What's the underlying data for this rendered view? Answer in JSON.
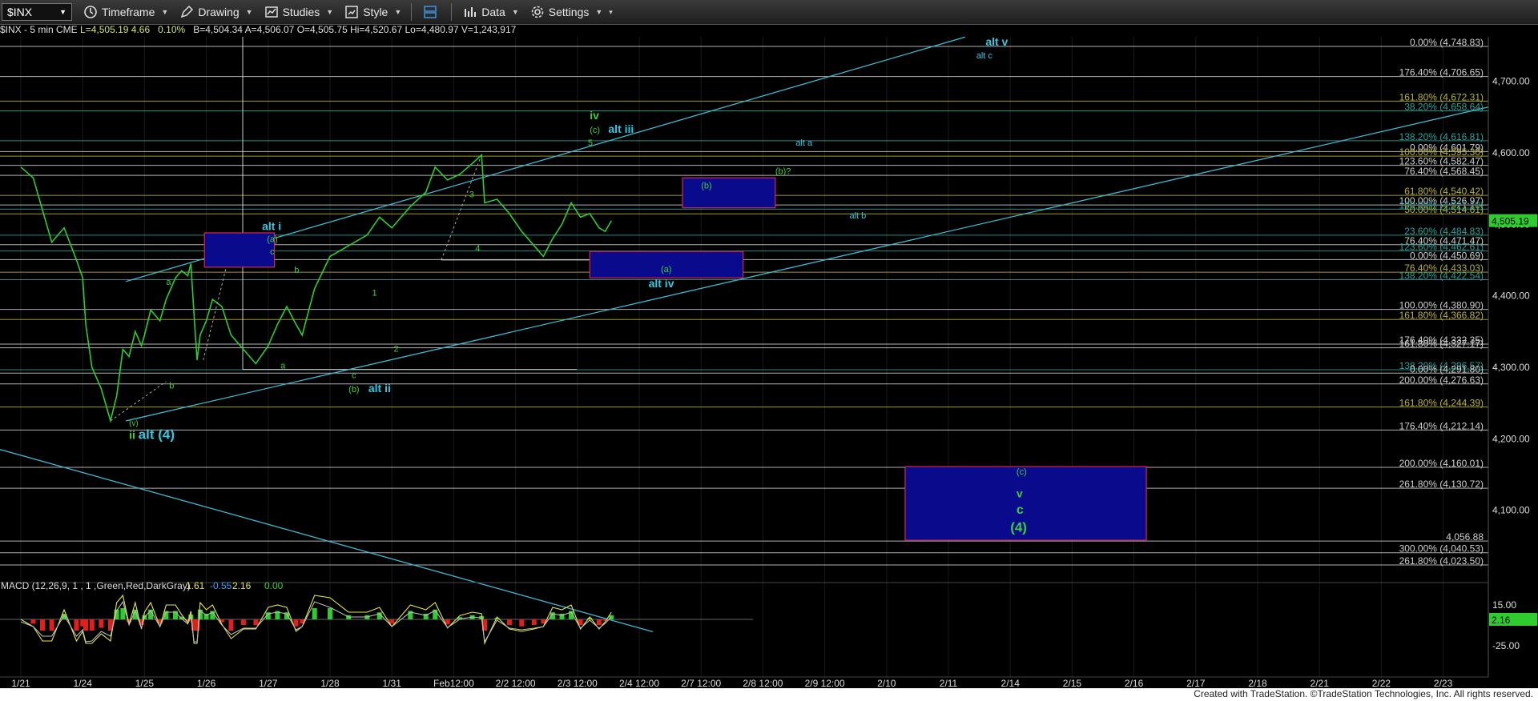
{
  "toolbar": {
    "symbol": "$INX",
    "items": [
      "Timeframe",
      "Drawing",
      "Studies",
      "Style",
      "Data",
      "Settings"
    ]
  },
  "infobar": {
    "symbol_line": "$INX - 5 min  CME",
    "last": "L=4,505.19",
    "change": "4.66",
    "change_pct": "0.10%",
    "bid": "B=4,504.34",
    "ask": "A=4,506.07",
    "open_ref": "O=4,505.75",
    "hi": "Hi=4,520.67",
    "lo": "Lo=4,480.97",
    "vol": "V=1,243,917"
  },
  "chart_data": {
    "type": "line",
    "title": "$INX - 5 min",
    "x_labels": [
      "1/21",
      "1/24",
      "1/25",
      "1/26",
      "1/27",
      "1/28",
      "1/31",
      "Feb12:00",
      "2/2 12:00",
      "2/3 12:00",
      "2/4 12:00",
      "2/7 12:00",
      "2/8 12:00",
      "2/9 12:00",
      "2/10",
      "2/11",
      "2/14",
      "2/15",
      "2/16",
      "2/17",
      "2/18",
      "2/21",
      "2/22",
      "2/23"
    ],
    "y_ticks": [
      "4,700.00",
      "4,600.00",
      "4,500.00",
      "4,400.00",
      "4,300.00",
      "4,200.00",
      "4,100.00"
    ],
    "ylim": [
      4010,
      4760
    ],
    "last_price_label": "4,505.19",
    "price_series": [
      {
        "x": 0.0,
        "y": 4580
      },
      {
        "x": 0.2,
        "y": 4565
      },
      {
        "x": 0.35,
        "y": 4520
      },
      {
        "x": 0.5,
        "y": 4475
      },
      {
        "x": 0.7,
        "y": 4495
      },
      {
        "x": 0.9,
        "y": 4450
      },
      {
        "x": 1.0,
        "y": 4425
      },
      {
        "x": 1.05,
        "y": 4360
      },
      {
        "x": 1.15,
        "y": 4300
      },
      {
        "x": 1.3,
        "y": 4270
      },
      {
        "x": 1.45,
        "y": 4225
      },
      {
        "x": 1.55,
        "y": 4260
      },
      {
        "x": 1.65,
        "y": 4325
      },
      {
        "x": 1.75,
        "y": 4315
      },
      {
        "x": 1.85,
        "y": 4350
      },
      {
        "x": 1.95,
        "y": 4330
      },
      {
        "x": 2.0,
        "y": 4345
      },
      {
        "x": 2.1,
        "y": 4380
      },
      {
        "x": 2.25,
        "y": 4365
      },
      {
        "x": 2.35,
        "y": 4395
      },
      {
        "x": 2.5,
        "y": 4425
      },
      {
        "x": 2.6,
        "y": 4435
      },
      {
        "x": 2.7,
        "y": 4428
      },
      {
        "x": 2.75,
        "y": 4445
      },
      {
        "x": 2.8,
        "y": 4375
      },
      {
        "x": 2.85,
        "y": 4310
      },
      {
        "x": 2.9,
        "y": 4345
      },
      {
        "x": 3.0,
        "y": 4365
      },
      {
        "x": 3.1,
        "y": 4395
      },
      {
        "x": 3.25,
        "y": 4385
      },
      {
        "x": 3.4,
        "y": 4345
      },
      {
        "x": 3.6,
        "y": 4325
      },
      {
        "x": 3.8,
        "y": 4305
      },
      {
        "x": 4.0,
        "y": 4330
      },
      {
        "x": 4.15,
        "y": 4360
      },
      {
        "x": 4.3,
        "y": 4385
      },
      {
        "x": 4.45,
        "y": 4360
      },
      {
        "x": 4.55,
        "y": 4345
      },
      {
        "x": 4.75,
        "y": 4410
      },
      {
        "x": 5.0,
        "y": 4455
      },
      {
        "x": 5.3,
        "y": 4470
      },
      {
        "x": 5.6,
        "y": 4485
      },
      {
        "x": 5.8,
        "y": 4510
      },
      {
        "x": 6.0,
        "y": 4495
      },
      {
        "x": 6.3,
        "y": 4525
      },
      {
        "x": 6.55,
        "y": 4545
      },
      {
        "x": 6.7,
        "y": 4580
      },
      {
        "x": 6.9,
        "y": 4562
      },
      {
        "x": 7.1,
        "y": 4570
      },
      {
        "x": 7.3,
        "y": 4585
      },
      {
        "x": 7.45,
        "y": 4597
      },
      {
        "x": 7.5,
        "y": 4530
      },
      {
        "x": 7.7,
        "y": 4535
      },
      {
        "x": 7.9,
        "y": 4515
      },
      {
        "x": 8.1,
        "y": 4490
      },
      {
        "x": 8.3,
        "y": 4470
      },
      {
        "x": 8.45,
        "y": 4455
      },
      {
        "x": 8.6,
        "y": 4480
      },
      {
        "x": 8.75,
        "y": 4500
      },
      {
        "x": 8.9,
        "y": 4530
      },
      {
        "x": 9.05,
        "y": 4510
      },
      {
        "x": 9.2,
        "y": 4515
      },
      {
        "x": 9.35,
        "y": 4495
      },
      {
        "x": 9.45,
        "y": 4490
      },
      {
        "x": 9.55,
        "y": 4505
      }
    ],
    "fib_levels": [
      {
        "label": "0.00% (4,748.83)",
        "y": 4748.83,
        "color": "#cfcfcf"
      },
      {
        "label": "176.40% (4,706.65)",
        "y": 4706.65,
        "color": "#cfcfcf"
      },
      {
        "label": "161.80% (4,672.31)",
        "y": 4672.31,
        "color": "#b8b23a"
      },
      {
        "label": "38.20% (4,658.64)",
        "y": 4658.64,
        "color": "#2aa39a"
      },
      {
        "label": "138.20% (4,616.81)",
        "y": 4616.81,
        "color": "#2aa39a"
      },
      {
        "label": "0.00% (4,601.79)",
        "y": 4601.79,
        "color": "#cfcfcf"
      },
      {
        "label": "100.00% (4,595.30)",
        "y": 4595.3,
        "color": "#b8b23a"
      },
      {
        "label": "123.60% (4,582.47)",
        "y": 4582.47,
        "color": "#cfcfcf"
      },
      {
        "label": "76.40% (4,568.45)",
        "y": 4568.45,
        "color": "#cfcfcf"
      },
      {
        "label": "61.80% (4,540.42)",
        "y": 4540.42,
        "color": "#b8b23a"
      },
      {
        "label": "100.00% (4,526.97)",
        "y": 4526.97,
        "color": "#cfcfcf"
      },
      {
        "label": "100.00% (4,521.10)",
        "y": 4521.1,
        "color": "#2aa39a"
      },
      {
        "label": "50.00% (4,514.61)",
        "y": 4514.61,
        "color": "#b8b23a"
      },
      {
        "label": "23.60% (4,484.83)",
        "y": 4484.83,
        "color": "#2aa39a"
      },
      {
        "label": "76.40% (4,471.47)",
        "y": 4471.47,
        "color": "#cfcfcf"
      },
      {
        "label": "123.60% (4,462.61)",
        "y": 4462.61,
        "color": "#2aa39a"
      },
      {
        "label": "0.00% (4,450.69)",
        "y": 4450.69,
        "color": "#cfcfcf"
      },
      {
        "label": "76.40% (4,433.03)",
        "y": 4433.03,
        "color": "#b8b23a"
      },
      {
        "label": "138.20% (4,422.54)",
        "y": 4422.54,
        "color": "#2aa39a"
      },
      {
        "label": "100.00% (4,380.90)",
        "y": 4380.9,
        "color": "#cfcfcf"
      },
      {
        "label": "161.80% (4,366.82)",
        "y": 4366.82,
        "color": "#b8b23a"
      },
      {
        "label": "176.40% (4,332.35)",
        "y": 4332.35,
        "color": "#cfcfcf"
      },
      {
        "label": "161.80% (4,327.17)",
        "y": 4327.17,
        "color": "#cfcfcf"
      },
      {
        "label": "138.20% (4,296.57)",
        "y": 4296.57,
        "color": "#2aa39a"
      },
      {
        "label": "0.00% (4,291.80)",
        "y": 4291.8,
        "color": "#cfcfcf"
      },
      {
        "label": "200.00% (4,276.63)",
        "y": 4276.63,
        "color": "#cfcfcf"
      },
      {
        "label": "161.80% (4,244.39)",
        "y": 4244.39,
        "color": "#b8b23a"
      },
      {
        "label": "176.40% (4,212.14)",
        "y": 4212.14,
        "color": "#cfcfcf"
      },
      {
        "label": "200.00% (4,160.01)",
        "y": 4160.01,
        "color": "#cfcfcf"
      },
      {
        "label": "261.80% (4,130.72)",
        "y": 4130.72,
        "color": "#cfcfcf"
      },
      {
        "label": "4,056.88",
        "y": 4056.88,
        "color": "#cfcfcf"
      },
      {
        "label": "300.00% (4,040.53)",
        "y": 4040.53,
        "color": "#cfcfcf"
      },
      {
        "label": "261.80% (4,023.50)",
        "y": 4023.5,
        "color": "#cfcfcf"
      }
    ],
    "boxes": [
      {
        "name": "alt-i-box",
        "x1": 2.97,
        "x2": 4.1,
        "y1": 4488,
        "y2": 4440
      },
      {
        "name": "b-box",
        "x1": 10.7,
        "x2": 12.2,
        "y1": 4565,
        "y2": 4523
      },
      {
        "name": "a-box",
        "x1": 9.2,
        "x2": 11.68,
        "y1": 4462,
        "y2": 4425
      },
      {
        "name": "target-box",
        "x1": 14.3,
        "x2": 18.2,
        "y1": 4161,
        "y2": 4058
      }
    ],
    "annotations": [
      {
        "text": "alt v",
        "x": 15.6,
        "y": 4750,
        "color": "#38c6e0",
        "size": 14,
        "bold": true
      },
      {
        "text": "alt c",
        "x": 15.45,
        "y": 4732,
        "color": "#38c6e0",
        "size": 11
      },
      {
        "text": "iv",
        "x": 9.2,
        "y": 4647,
        "color": "#3ccf3c",
        "size": 14,
        "bold": true
      },
      {
        "text": "(c)",
        "x": 9.2,
        "y": 4628,
        "color": "#3ccf3c",
        "size": 11
      },
      {
        "text": "alt iii",
        "x": 9.5,
        "y": 4628,
        "color": "#38c6e0",
        "size": 14,
        "bold": true
      },
      {
        "text": "5",
        "x": 9.17,
        "y": 4610,
        "color": "#3ccf3c",
        "size": 11
      },
      {
        "text": "alt a",
        "x": 12.53,
        "y": 4610,
        "color": "#38c6e0",
        "size": 11
      },
      {
        "text": "(b)?",
        "x": 12.2,
        "y": 4570,
        "color": "#3ccf3c",
        "size": 11
      },
      {
        "text": "(b)",
        "x": 11.0,
        "y": 4550,
        "color": "#3ccf3c",
        "size": 11
      },
      {
        "text": "alt b",
        "x": 13.4,
        "y": 4508,
        "color": "#38c6e0",
        "size": 11
      },
      {
        "text": "3",
        "x": 7.25,
        "y": 4538,
        "color": "#3ccf3c",
        "size": 11
      },
      {
        "text": "4",
        "x": 7.35,
        "y": 4462,
        "color": "#3ccf3c",
        "size": 11
      },
      {
        "text": "alt i",
        "x": 3.9,
        "y": 4492,
        "color": "#38c6e0",
        "size": 14,
        "bold": true
      },
      {
        "text": "(a)",
        "x": 3.98,
        "y": 4475,
        "color": "#3ccf3c",
        "size": 11
      },
      {
        "text": "c",
        "x": 4.03,
        "y": 4458,
        "color": "#3ccf3c",
        "size": 11
      },
      {
        "text": "b",
        "x": 4.42,
        "y": 4432,
        "color": "#3ccf3c",
        "size": 11
      },
      {
        "text": "a",
        "x": 2.35,
        "y": 4415,
        "color": "#3ccf3c",
        "size": 11
      },
      {
        "text": "(a)",
        "x": 10.35,
        "y": 4433,
        "color": "#3ccf3c",
        "size": 11
      },
      {
        "text": "alt iv",
        "x": 10.15,
        "y": 4412,
        "color": "#38c6e0",
        "size": 14,
        "bold": true
      },
      {
        "text": "1",
        "x": 5.68,
        "y": 4400,
        "color": "#3ccf3c",
        "size": 11
      },
      {
        "text": "2",
        "x": 6.03,
        "y": 4322,
        "color": "#3ccf3c",
        "size": 11
      },
      {
        "text": "a",
        "x": 4.2,
        "y": 4298,
        "color": "#3ccf3c",
        "size": 11
      },
      {
        "text": "c",
        "x": 5.35,
        "y": 4285,
        "color": "#3ccf3c",
        "size": 11
      },
      {
        "text": "(b)",
        "x": 5.3,
        "y": 4265,
        "color": "#3ccf3c",
        "size": 11
      },
      {
        "text": "alt ii",
        "x": 5.62,
        "y": 4265,
        "color": "#38c6e0",
        "size": 14,
        "bold": true
      },
      {
        "text": "b",
        "x": 2.4,
        "y": 4270,
        "color": "#3ccf3c",
        "size": 11
      },
      {
        "text": "(v)",
        "x": 1.75,
        "y": 4218,
        "color": "#3ccf3c",
        "size": 10
      },
      {
        "text": "ii",
        "x": 1.75,
        "y": 4200,
        "color": "#3ccf3c",
        "size": 14,
        "bold": true
      },
      {
        "text": "alt (4)",
        "x": 1.9,
        "y": 4200,
        "color": "#38c6e0",
        "size": 17,
        "bold": true
      },
      {
        "text": "(c)",
        "x": 16.1,
        "y": 4150,
        "color": "#3ccf3c",
        "size": 11
      },
      {
        "text": "v",
        "x": 16.1,
        "y": 4118,
        "color": "#3ccf3c",
        "size": 14,
        "bold": true
      },
      {
        "text": "c",
        "x": 16.1,
        "y": 4095,
        "color": "#3ccf3c",
        "size": 16,
        "bold": true
      },
      {
        "text": "(4)",
        "x": 16.0,
        "y": 4070,
        "color": "#3ccf3c",
        "size": 17,
        "bold": true
      }
    ],
    "macd": {
      "label": "MACD (12,26,9, 1 , 1 ,Green,Red,DarkGray)",
      "values": [
        "1.61",
        "-0.55",
        "2.16",
        "0.00"
      ],
      "y_ticks": [
        "15.00",
        "-25.00"
      ],
      "last_label": "2.16"
    }
  },
  "footer": {
    "credit": "Created with TradeStation. ©TradeStation Technologies, Inc. All rights reserved."
  },
  "colors": {
    "background": "#000000",
    "price": "#2ecc2e",
    "wave_green": "#3ccf3c",
    "wave_cyan": "#38c6e0",
    "trend_line": "#3fb6d0",
    "box_fill": "#0a0a8c",
    "box_border": "#d22a4a"
  }
}
